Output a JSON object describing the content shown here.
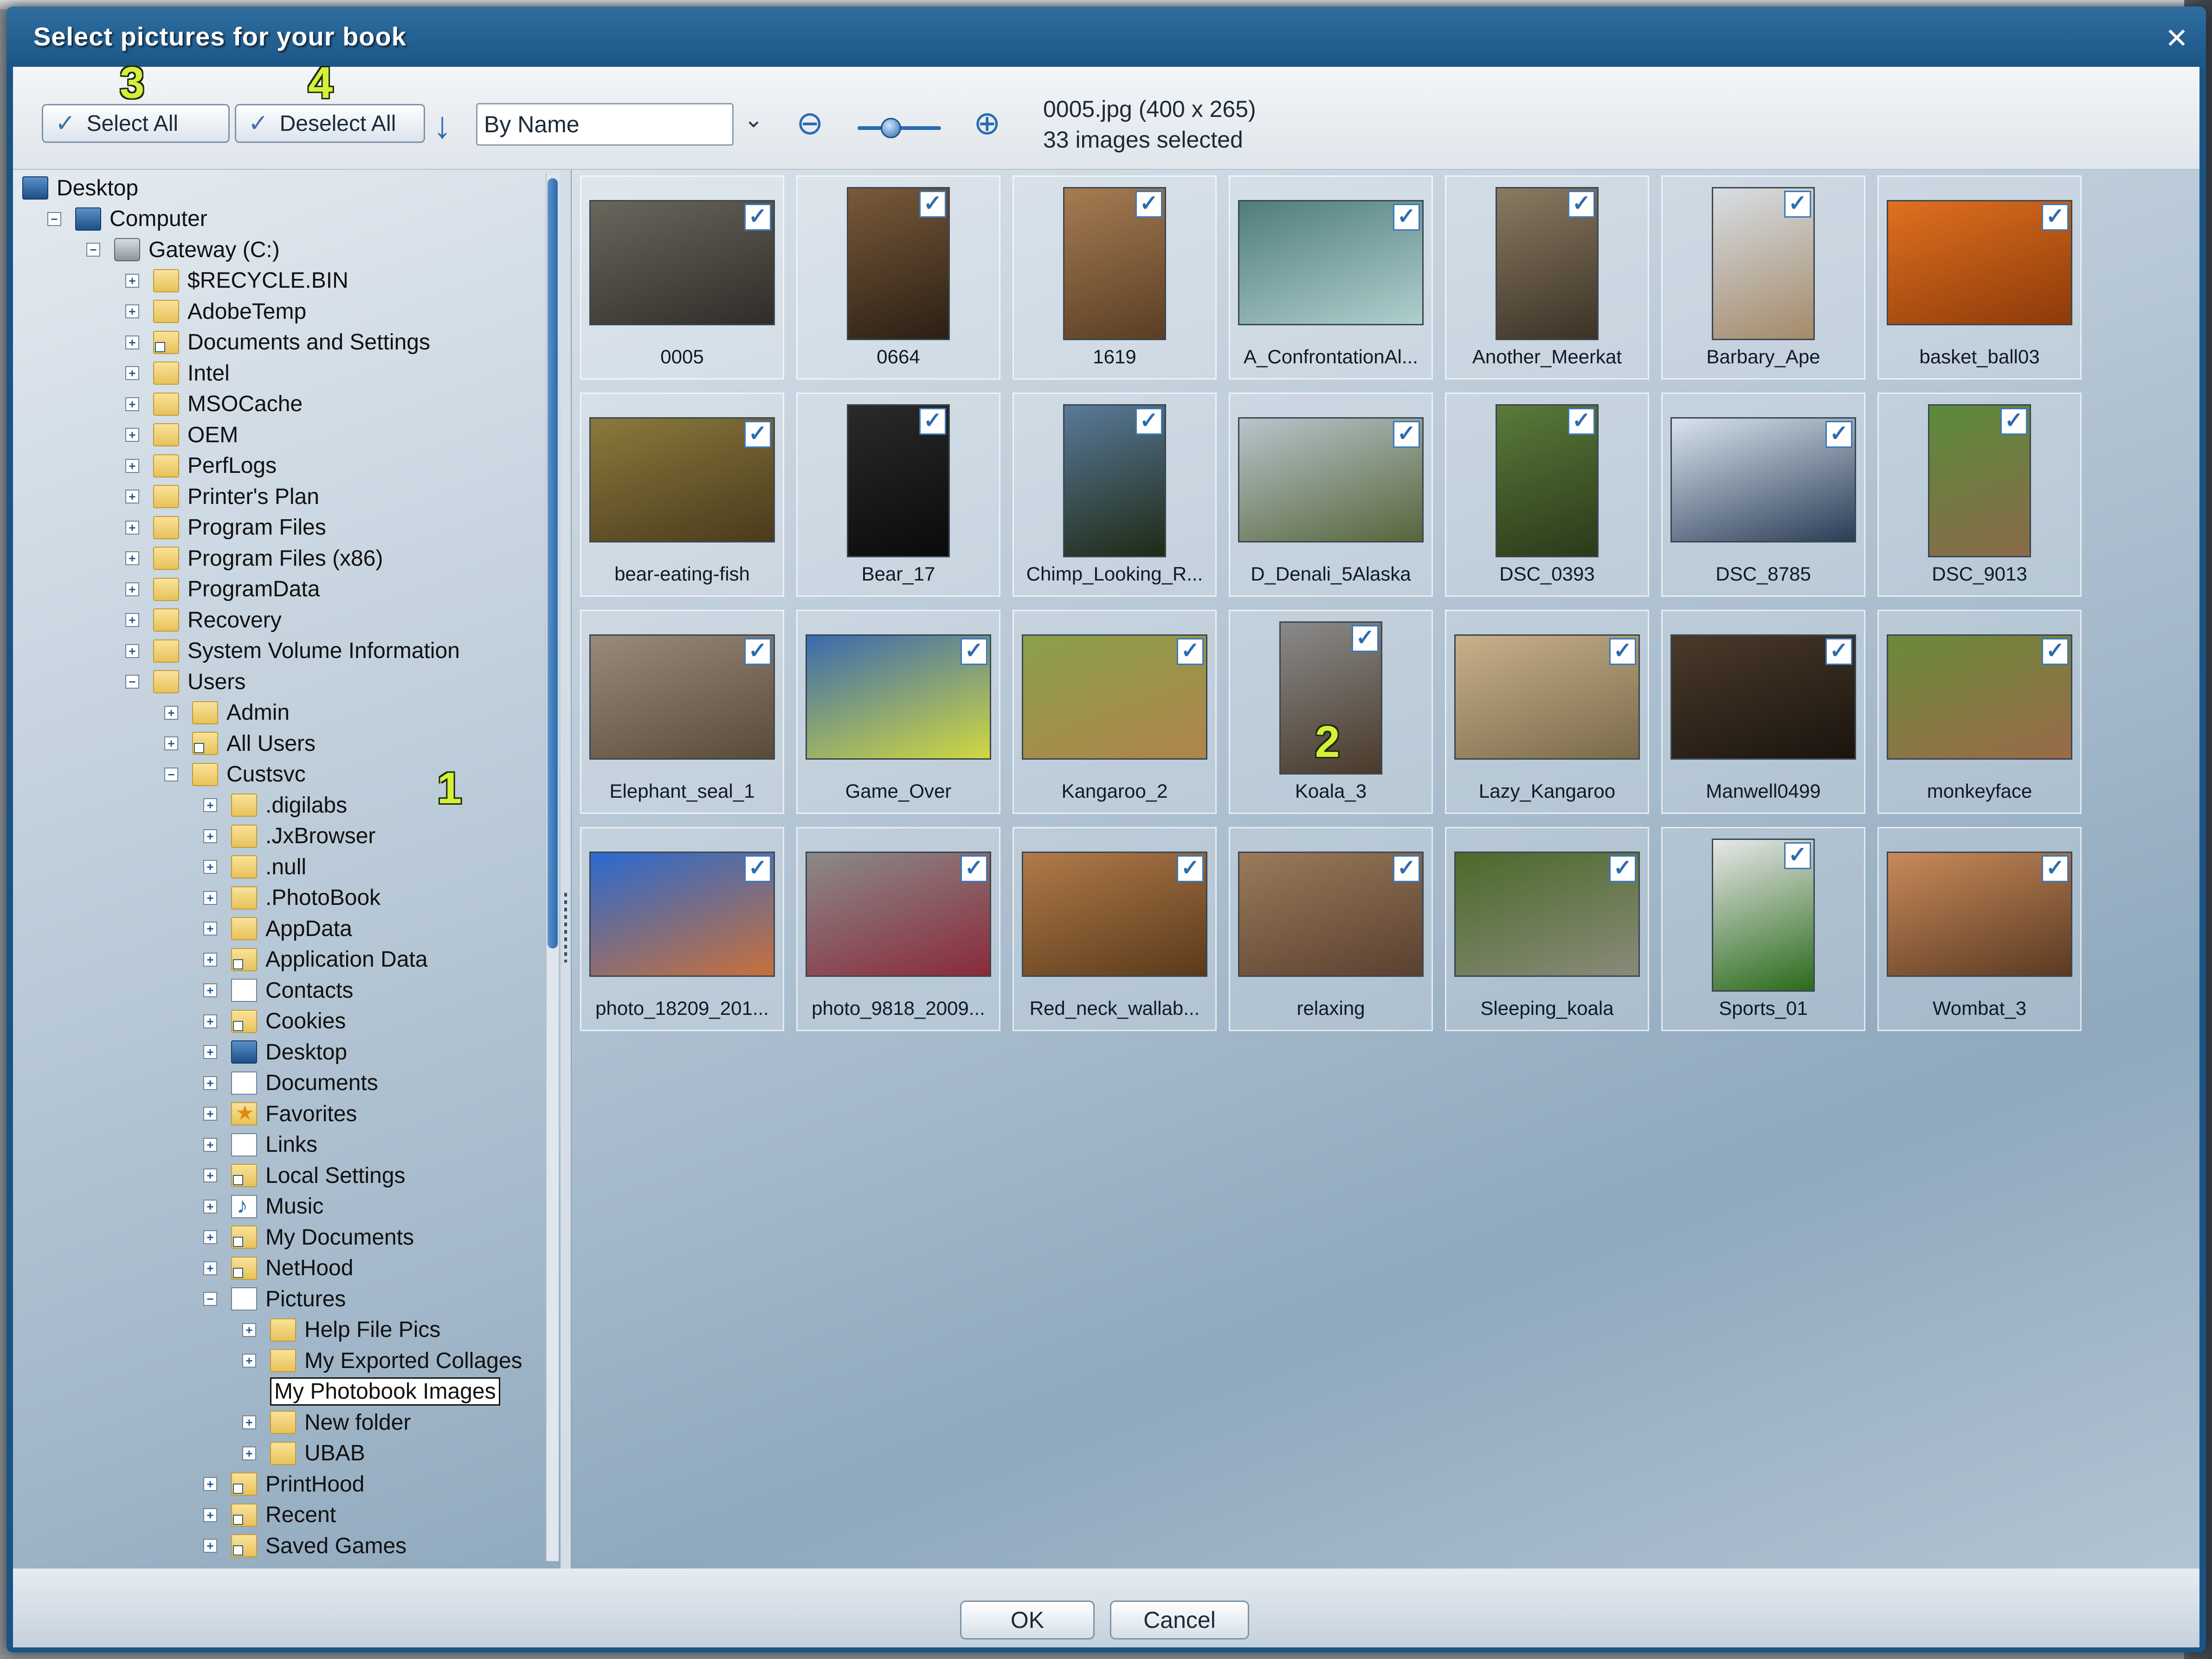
{
  "window": {
    "title": "Select pictures for your book",
    "close_glyph": "✕"
  },
  "toolbar": {
    "select_all": "Select All",
    "deselect_all": "Deselect All",
    "sort_value": "By Name",
    "info_line1": "0005.jpg (400 x 265)",
    "info_line2": "33 images selected",
    "zoom_level": 0.4
  },
  "badges": {
    "b1": "1",
    "b2": "2",
    "b3": "3",
    "b4": "4"
  },
  "tree": [
    {
      "label": "Desktop",
      "depth": 0,
      "toggle": "",
      "icon": "pc"
    },
    {
      "label": "Computer",
      "depth": 1,
      "toggle": "−",
      "icon": "pc"
    },
    {
      "label": "Gateway (C:)",
      "depth": 2,
      "toggle": "−",
      "icon": "drive"
    },
    {
      "label": "$RECYCLE.BIN",
      "depth": 3,
      "toggle": "+",
      "icon": "folder"
    },
    {
      "label": "AdobeTemp",
      "depth": 3,
      "toggle": "+",
      "icon": "folder"
    },
    {
      "label": "Documents and Settings",
      "depth": 3,
      "toggle": "+",
      "icon": "shortcut"
    },
    {
      "label": "Intel",
      "depth": 3,
      "toggle": "+",
      "icon": "folder"
    },
    {
      "label": "MSOCache",
      "depth": 3,
      "toggle": "+",
      "icon": "folder"
    },
    {
      "label": "OEM",
      "depth": 3,
      "toggle": "+",
      "icon": "folder"
    },
    {
      "label": "PerfLogs",
      "depth": 3,
      "toggle": "+",
      "icon": "folder"
    },
    {
      "label": "Printer's Plan",
      "depth": 3,
      "toggle": "+",
      "icon": "folder"
    },
    {
      "label": "Program Files",
      "depth": 3,
      "toggle": "+",
      "icon": "folder"
    },
    {
      "label": "Program Files (x86)",
      "depth": 3,
      "toggle": "+",
      "icon": "folder"
    },
    {
      "label": "ProgramData",
      "depth": 3,
      "toggle": "+",
      "icon": "folder"
    },
    {
      "label": "Recovery",
      "depth": 3,
      "toggle": "+",
      "icon": "folder"
    },
    {
      "label": "System Volume Information",
      "depth": 3,
      "toggle": "+",
      "icon": "folder"
    },
    {
      "label": "Users",
      "depth": 3,
      "toggle": "−",
      "icon": "folder"
    },
    {
      "label": "Admin",
      "depth": 4,
      "toggle": "+",
      "icon": "folder"
    },
    {
      "label": "All Users",
      "depth": 4,
      "toggle": "+",
      "icon": "shortcut"
    },
    {
      "label": "Custsvc",
      "depth": 4,
      "toggle": "−",
      "icon": "folder"
    },
    {
      "label": ".digilabs",
      "depth": 5,
      "toggle": "+",
      "icon": "folder"
    },
    {
      "label": ".JxBrowser",
      "depth": 5,
      "toggle": "+",
      "icon": "folder"
    },
    {
      "label": ".null",
      "depth": 5,
      "toggle": "+",
      "icon": "folder"
    },
    {
      "label": ".PhotoBook",
      "depth": 5,
      "toggle": "+",
      "icon": "folder"
    },
    {
      "label": "AppData",
      "depth": 5,
      "toggle": "+",
      "icon": "folder"
    },
    {
      "label": "Application Data",
      "depth": 5,
      "toggle": "+",
      "icon": "shortcut"
    },
    {
      "label": "Contacts",
      "depth": 5,
      "toggle": "+",
      "icon": "page"
    },
    {
      "label": "Cookies",
      "depth": 5,
      "toggle": "+",
      "icon": "shortcut"
    },
    {
      "label": "Desktop",
      "depth": 5,
      "toggle": "+",
      "icon": "pc"
    },
    {
      "label": "Documents",
      "depth": 5,
      "toggle": "+",
      "icon": "page"
    },
    {
      "label": "Favorites",
      "depth": 5,
      "toggle": "+",
      "icon": "star"
    },
    {
      "label": "Links",
      "depth": 5,
      "toggle": "+",
      "icon": "page"
    },
    {
      "label": "Local Settings",
      "depth": 5,
      "toggle": "+",
      "icon": "shortcut"
    },
    {
      "label": "Music",
      "depth": 5,
      "toggle": "+",
      "icon": "music"
    },
    {
      "label": "My Documents",
      "depth": 5,
      "toggle": "+",
      "icon": "shortcut"
    },
    {
      "label": "NetHood",
      "depth": 5,
      "toggle": "+",
      "icon": "shortcut"
    },
    {
      "label": "Pictures",
      "depth": 5,
      "toggle": "−",
      "icon": "page"
    },
    {
      "label": "Help File Pics",
      "depth": 6,
      "toggle": "+",
      "icon": "folder"
    },
    {
      "label": "My Exported Collages",
      "depth": 6,
      "toggle": "+",
      "icon": "folder"
    },
    {
      "label": "My Photobook Images",
      "depth": 6,
      "toggle": "",
      "icon": "none",
      "selected": true
    },
    {
      "label": "New folder",
      "depth": 6,
      "toggle": "+",
      "icon": "folder"
    },
    {
      "label": "UBAB",
      "depth": 6,
      "toggle": "+",
      "icon": "folder"
    },
    {
      "label": "PrintHood",
      "depth": 5,
      "toggle": "+",
      "icon": "shortcut"
    },
    {
      "label": "Recent",
      "depth": 5,
      "toggle": "+",
      "icon": "shortcut"
    },
    {
      "label": "Saved Games",
      "depth": 5,
      "toggle": "+",
      "icon": "shortcut"
    }
  ],
  "thumbs": [
    {
      "caption": "0005",
      "orient": "land",
      "c1": "#6b665c",
      "c2": "#2f2d29"
    },
    {
      "caption": "0664",
      "orient": "port",
      "c1": "#7a5a3a",
      "c2": "#2a1f14"
    },
    {
      "caption": "1619",
      "orient": "port",
      "c1": "#a67c52",
      "c2": "#5a3e24"
    },
    {
      "caption": "A_ConfrontationAl...",
      "orient": "land",
      "c1": "#4f7d7a",
      "c2": "#b0cfcf"
    },
    {
      "caption": "Another_Meerkat",
      "orient": "port",
      "c1": "#8a7a62",
      "c2": "#3c3226"
    },
    {
      "caption": "Barbary_Ape",
      "orient": "port",
      "c1": "#d8dee4",
      "c2": "#a48a6a"
    },
    {
      "caption": "basket_ball03",
      "orient": "land",
      "c1": "#e0701f",
      "c2": "#8c3a0a"
    },
    {
      "caption": "bear-eating-fish",
      "orient": "land",
      "c1": "#8a7a3c",
      "c2": "#4a3a1c"
    },
    {
      "caption": "Bear_17",
      "orient": "port",
      "c1": "#2a2a2a",
      "c2": "#0a0a0a"
    },
    {
      "caption": "Chimp_Looking_R...",
      "orient": "port",
      "c1": "#5a7a9a",
      "c2": "#1e2a14"
    },
    {
      "caption": "D_Denali_5Alaska",
      "orient": "land",
      "c1": "#b8c4cc",
      "c2": "#56663a"
    },
    {
      "caption": "DSC_0393",
      "orient": "port",
      "c1": "#5a7a3a",
      "c2": "#2a3a1a"
    },
    {
      "caption": "DSC_8785",
      "orient": "land",
      "c1": "#d8e4ee",
      "c2": "#2a3c56"
    },
    {
      "caption": "DSC_9013",
      "orient": "port",
      "c1": "#5a8a3a",
      "c2": "#8a6a4a"
    },
    {
      "caption": "Elephant_seal_1",
      "orient": "land",
      "c1": "#9a8a7a",
      "c2": "#5a4a3a"
    },
    {
      "caption": "Game_Over",
      "orient": "land",
      "c1": "#3a6ab0",
      "c2": "#d0d840"
    },
    {
      "caption": "Kangaroo_2",
      "orient": "land",
      "c1": "#8aa04a",
      "c2": "#b0844a"
    },
    {
      "caption": "Koala_3",
      "orient": "port",
      "c1": "#8a8a8a",
      "c2": "#4a3a2a"
    },
    {
      "caption": "Lazy_Kangaroo",
      "orient": "land",
      "c1": "#c8b08a",
      "c2": "#7a6a4a"
    },
    {
      "caption": "Manwell0499",
      "orient": "land",
      "c1": "#4a3a2a",
      "c2": "#1a140e"
    },
    {
      "caption": "monkeyface",
      "orient": "land",
      "c1": "#6a8a3a",
      "c2": "#9a6a4a"
    },
    {
      "caption": "photo_18209_201...",
      "orient": "land",
      "c1": "#2a6ad0",
      "c2": "#c8703a"
    },
    {
      "caption": "photo_9818_2009...",
      "orient": "land",
      "c1": "#8a8a8a",
      "c2": "#8a2a3a"
    },
    {
      "caption": "Red_neck_wallab...",
      "orient": "land",
      "c1": "#b07a4a",
      "c2": "#5a3a1a"
    },
    {
      "caption": "relaxing",
      "orient": "land",
      "c1": "#9a7a5a",
      "c2": "#5a4030"
    },
    {
      "caption": "Sleeping_koala",
      "orient": "land",
      "c1": "#4a6a2a",
      "c2": "#8a8a7a"
    },
    {
      "caption": "Sports_01",
      "orient": "port",
      "c1": "#e8e8ea",
      "c2": "#2a6a1a"
    },
    {
      "caption": "Wombat_3",
      "orient": "land",
      "c1": "#c88a5a",
      "c2": "#5a3a22"
    }
  ],
  "footer": {
    "ok": "OK",
    "cancel": "Cancel"
  },
  "colors": {
    "accent": "#2a6bb0",
    "title_bar": "#1a5485",
    "badge": "#d6f03a"
  }
}
